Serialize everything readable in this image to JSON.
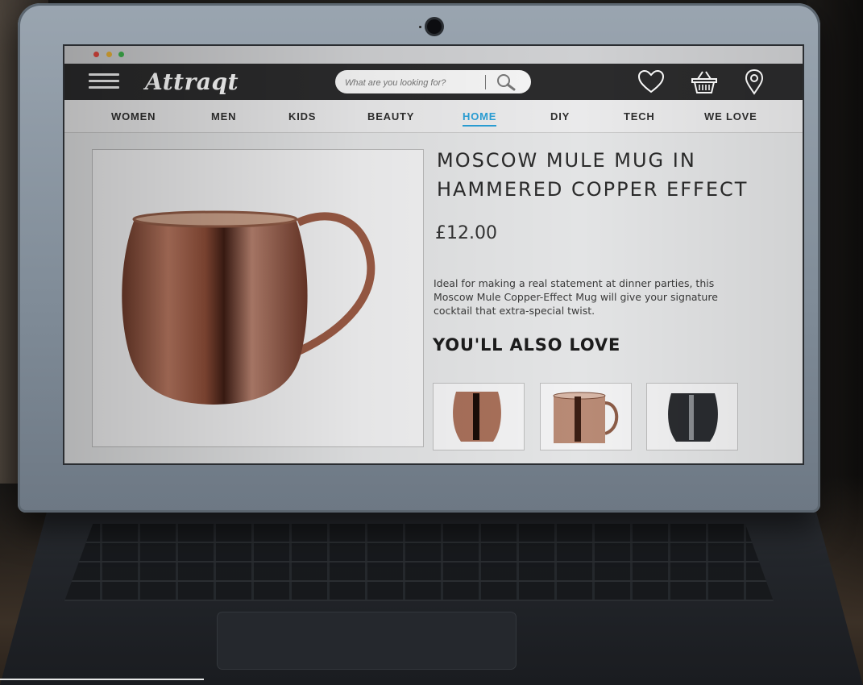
{
  "brand": {
    "logo_text": "Attraqt",
    "accent": "#2a9fd6",
    "topbar_bg": "#2b2b2c"
  },
  "search": {
    "placeholder": "What are you looking for?"
  },
  "header_icons": [
    "menu-icon",
    "heart-icon",
    "basket-icon",
    "location-pin-icon"
  ],
  "categories": [
    {
      "label": "WOMEN",
      "active": false
    },
    {
      "label": "MEN",
      "active": false
    },
    {
      "label": "KIDS",
      "active": false
    },
    {
      "label": "BEAUTY",
      "active": false
    },
    {
      "label": "HOME",
      "active": true
    },
    {
      "label": "DIY",
      "active": false
    },
    {
      "label": "TECH",
      "active": false
    },
    {
      "label": "WE LOVE",
      "active": false
    }
  ],
  "product": {
    "title": "MOSCOW MULE MUG IN HAMMERED COPPER EFFECT",
    "price": "£12.00",
    "description": "Ideal for making a real statement at dinner parties, this Moscow Mule Copper-Effect Mug will give your signature cocktail that extra-special twist."
  },
  "recommendations": {
    "heading": "YOU'LL ALSO LOVE",
    "items": [
      {
        "name": "copper-tumbler-thumbnail"
      },
      {
        "name": "copper-mug-thumbnail"
      },
      {
        "name": "black-tumbler-thumbnail"
      }
    ]
  }
}
